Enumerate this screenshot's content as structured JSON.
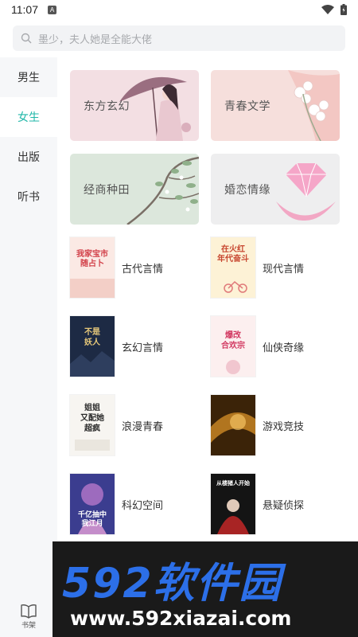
{
  "status_bar": {
    "time": "11:07",
    "notification_badge": "A",
    "icons": [
      "wifi-icon",
      "battery-icon"
    ]
  },
  "search": {
    "placeholder": "墨少，夫人她是全能大佬",
    "icon": "search-icon"
  },
  "sidebar": {
    "items": [
      {
        "label": "男生",
        "active": false
      },
      {
        "label": "女生",
        "active": true
      },
      {
        "label": "出版",
        "active": false
      },
      {
        "label": "听书",
        "active": false
      }
    ],
    "footer": {
      "label": "书架",
      "icon": "book-icon"
    },
    "active_color": "#22b7a9"
  },
  "banners": [
    {
      "label": "东方玄幻",
      "bg": "#f3dfe3"
    },
    {
      "label": "青春文学",
      "bg": "#f6dfdc"
    },
    {
      "label": "经商种田",
      "bg": "#dce7dc"
    },
    {
      "label": "婚恋情缘",
      "bg": "#eeeeef"
    }
  ],
  "genres": [
    {
      "label": "古代言情",
      "cover_text": [
        "我家宝市",
        "随占卜"
      ]
    },
    {
      "label": "现代言情",
      "cover_text": [
        "在火红",
        "年代奋斗"
      ]
    },
    {
      "label": "玄幻言情",
      "cover_text": [
        "不是",
        "妖人"
      ]
    },
    {
      "label": "仙侠奇缘",
      "cover_text": [
        "爆改",
        "合欢宗"
      ]
    },
    {
      "label": "浪漫青春",
      "cover_text": [
        "姐姐",
        "又配她",
        "超疯"
      ]
    },
    {
      "label": "游戏竞技",
      "cover_text": []
    },
    {
      "label": "科幻空间",
      "cover_text": [
        "千亿抽中",
        "我江月"
      ]
    },
    {
      "label": "悬疑侦探",
      "cover_text": [
        "从楼猪人开始"
      ]
    }
  ],
  "watermark": {
    "logo": "592软件园",
    "url": "www.592xiazai.com"
  }
}
